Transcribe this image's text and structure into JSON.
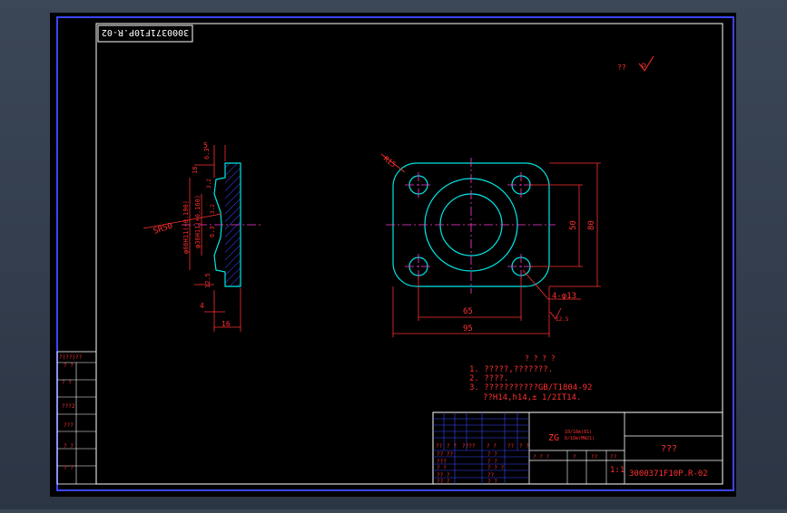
{
  "drawing_number_top": "3000371F10P.R-02",
  "mirrored_number": "3000371F10P.R-02",
  "roughness_note": "??",
  "notes": {
    "title": "? ? ? ?",
    "line1": "1. ?????,???????.",
    "line2": "2. ????.",
    "line3": "3. ???????????GB/T1804-92",
    "line4": "??H14,h14,±  1/2IT14."
  },
  "side_view": {
    "d5": "5",
    "d18": "18",
    "sr50": "SR50",
    "d4": "4",
    "d16": "16",
    "dia66": "φ66H11(+0.190)",
    "dia36": "φ36H11(+0.160)",
    "r63a": "6.3",
    "r63b": "6.3",
    "r125": "12.5",
    "small1": "3.2",
    "small2": "3.2"
  },
  "front_view": {
    "r15": "R15",
    "d50": "50",
    "d80": "80",
    "d65": "65",
    "d95": "95",
    "holes": "4-φ13",
    "r125b": "12.5"
  },
  "title_block": {
    "left_labels": [
      "?(??)??",
      "? ?",
      "?  ?",
      "???2",
      "???",
      "? ?",
      "? ?"
    ],
    "material": "ZG",
    "material_sub1": "10/18m(81)",
    "material_sub2": "D/18m(MW21)",
    "name": "???",
    "scale": "1:1",
    "drawing_number": "3000371F10P.R-02",
    "row_labels": [
      "?? ??",
      "???",
      "? ?",
      "?? ?",
      "?? ?"
    ],
    "grid_row1": [
      "??",
      "? ?",
      "????",
      "? ?",
      "??",
      "? ?"
    ],
    "grid_row2": [
      "? ?",
      "? ?",
      "? ? ?",
      "??",
      "? ?",
      "? ?"
    ],
    "scale_row": [
      "? ? ?",
      "?",
      "??",
      "??"
    ]
  }
}
